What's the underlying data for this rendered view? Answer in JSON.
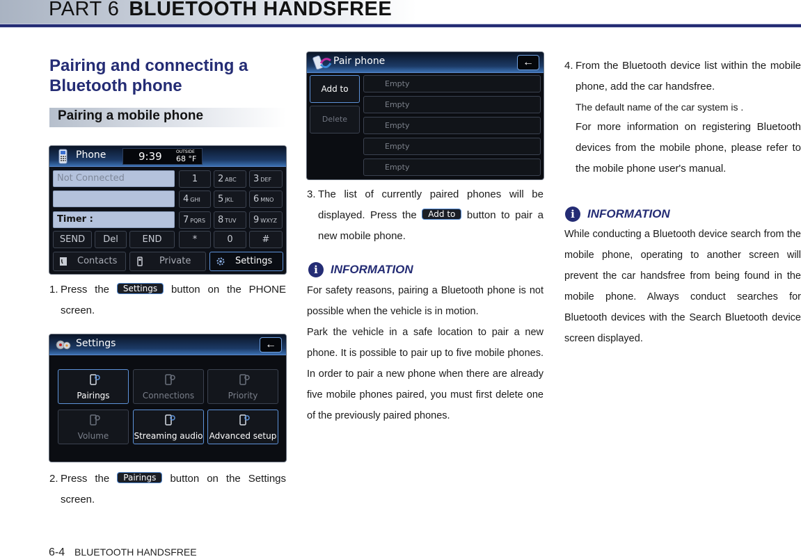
{
  "header": {
    "part": "PART 6",
    "chapter": "BLUETOOTH HANDSFREE"
  },
  "section": {
    "title": "Pairing and connecting a Bluetooth phone",
    "subsection": "Pairing a mobile phone"
  },
  "phone_screen": {
    "title": "Phone",
    "clock": "9:39",
    "outside_label": "OUTSIDE",
    "outside_temp": "68 °F",
    "status": "Not Connected",
    "number_field": "",
    "timer_label": "Timer :",
    "keys": [
      {
        "digit": "1",
        "letters": ""
      },
      {
        "digit": "2",
        "letters": "ABC"
      },
      {
        "digit": "3",
        "letters": "DEF"
      },
      {
        "digit": "4",
        "letters": "GHI"
      },
      {
        "digit": "5",
        "letters": "JKL"
      },
      {
        "digit": "6",
        "letters": "MNO"
      },
      {
        "digit": "7",
        "letters": "PQRS"
      },
      {
        "digit": "8",
        "letters": "TUV"
      },
      {
        "digit": "9",
        "letters": "WXYZ"
      },
      {
        "digit": "*",
        "letters": ""
      },
      {
        "digit": "0",
        "letters": ""
      },
      {
        "digit": "#",
        "letters": ""
      }
    ],
    "call_buttons": [
      "SEND",
      "Del",
      "END"
    ],
    "bottom_buttons": {
      "contacts": "Contacts",
      "private": "Private",
      "settings": "Settings"
    }
  },
  "steps": [
    {
      "num": "1.",
      "pre": "Press the",
      "button": "Settings",
      "post": "button on the PHONE screen."
    },
    {
      "num": "2.",
      "pre": "Press the",
      "button": "Pairings",
      "post": "button on the Settings screen."
    },
    {
      "num": "3.",
      "pre": "The list of currently paired phones will be displayed.  Press the",
      "button": "Add to",
      "post": "button to pair a new mobile phone."
    },
    {
      "num": "4.",
      "line1": "From the Bluetooth device list within the mobile phone, add the car handsfree.",
      "line2": "The default name of the car system is .",
      "line3": "For more information on registering Bluetooth devices from the mobile phone, please refer to the mobile phone user's manual."
    }
  ],
  "settings_screen": {
    "title": "Settings",
    "back": "←",
    "tiles": [
      {
        "label": "Pairings",
        "enabled": true
      },
      {
        "label": "Connections",
        "enabled": false
      },
      {
        "label": "Priority",
        "enabled": false
      },
      {
        "label": "Volume",
        "enabled": false
      },
      {
        "label": "Streaming audio",
        "enabled": true
      },
      {
        "label": "Advanced setup",
        "enabled": true
      }
    ]
  },
  "pair_screen": {
    "title": "Pair phone",
    "back": "←",
    "add_to": "Add to",
    "delete": "Delete",
    "slots": [
      "Empty",
      "Empty",
      "Empty",
      "Empty",
      "Empty"
    ]
  },
  "info1": {
    "label": "INFORMATION",
    "p1": "For safety reasons, pairing a Bluetooth phone is not possible when the vehicle is in motion.",
    "p2": "Park the vehicle in a safe location to pair a new phone. It is possible to pair up to five mobile phones. In order to pair a new phone when there are already five mobile phones paired, you must first delete one of the previously paired phones."
  },
  "info2": {
    "label": "INFORMATION",
    "p1": "While conducting a Bluetooth device search from the mobile phone, operating to another screen will prevent the car handsfree from being found in the mobile phone. Always conduct searches for Bluetooth devices with the Search Bluetooth device screen displayed."
  },
  "footer": {
    "page": "6-4",
    "chapter": "BLUETOOTH HANDSFREE"
  },
  "colors": {
    "brand": "#242c74",
    "button_border": "#5e93da"
  }
}
